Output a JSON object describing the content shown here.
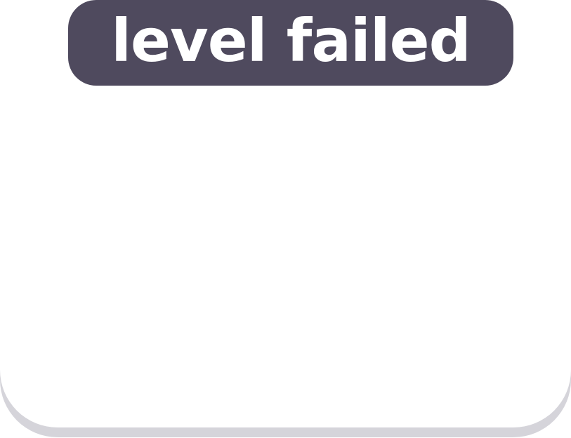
{
  "dialog": {
    "title": "level failed"
  },
  "colors": {
    "banner": "#4f4a5e",
    "panel": "#ffffff",
    "panel_shadow": "#d5d4da",
    "title_text": "#ffffff"
  }
}
